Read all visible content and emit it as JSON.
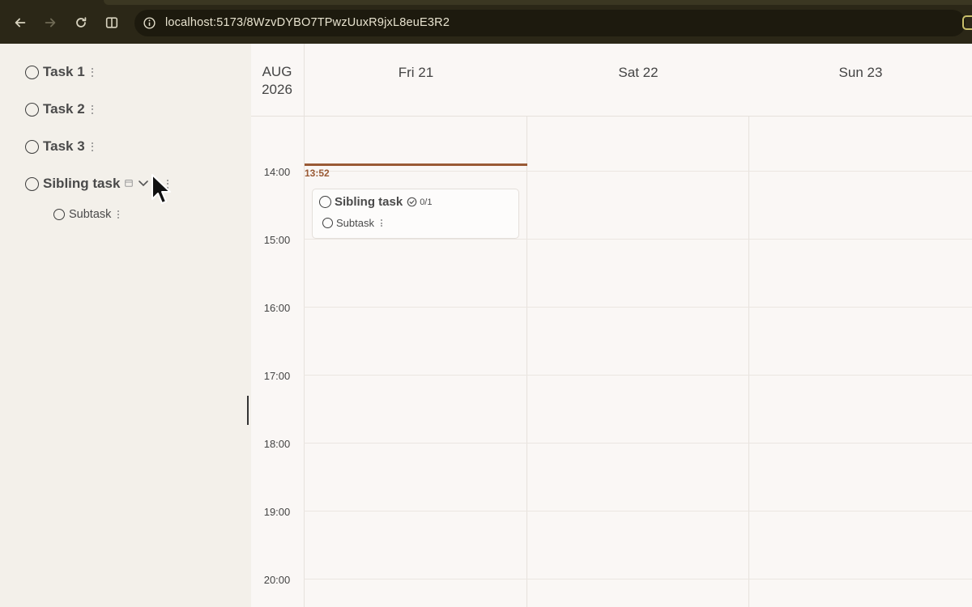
{
  "browser": {
    "url": "localhost:5173/8WzvDYBO7TPwzUuxR9jxL8euE3R2"
  },
  "sidebar": {
    "tasks": [
      {
        "label": "Task 1"
      },
      {
        "label": "Task 2"
      },
      {
        "label": "Task 3"
      },
      {
        "label": "Sibling task",
        "subtasks": [
          {
            "label": "Subtask"
          }
        ]
      }
    ]
  },
  "calendar": {
    "month": "AUG",
    "year": "2026",
    "days": [
      "Fri 21",
      "Sat 22",
      "Sun 23"
    ],
    "times": [
      "14:00",
      "15:00",
      "16:00",
      "17:00",
      "18:00",
      "19:00",
      "20:00"
    ],
    "now_label": "13:52",
    "now_color": "#9a5a35",
    "event": {
      "title": "Sibling task",
      "progress": "0/1",
      "subtask": "Subtask"
    }
  }
}
